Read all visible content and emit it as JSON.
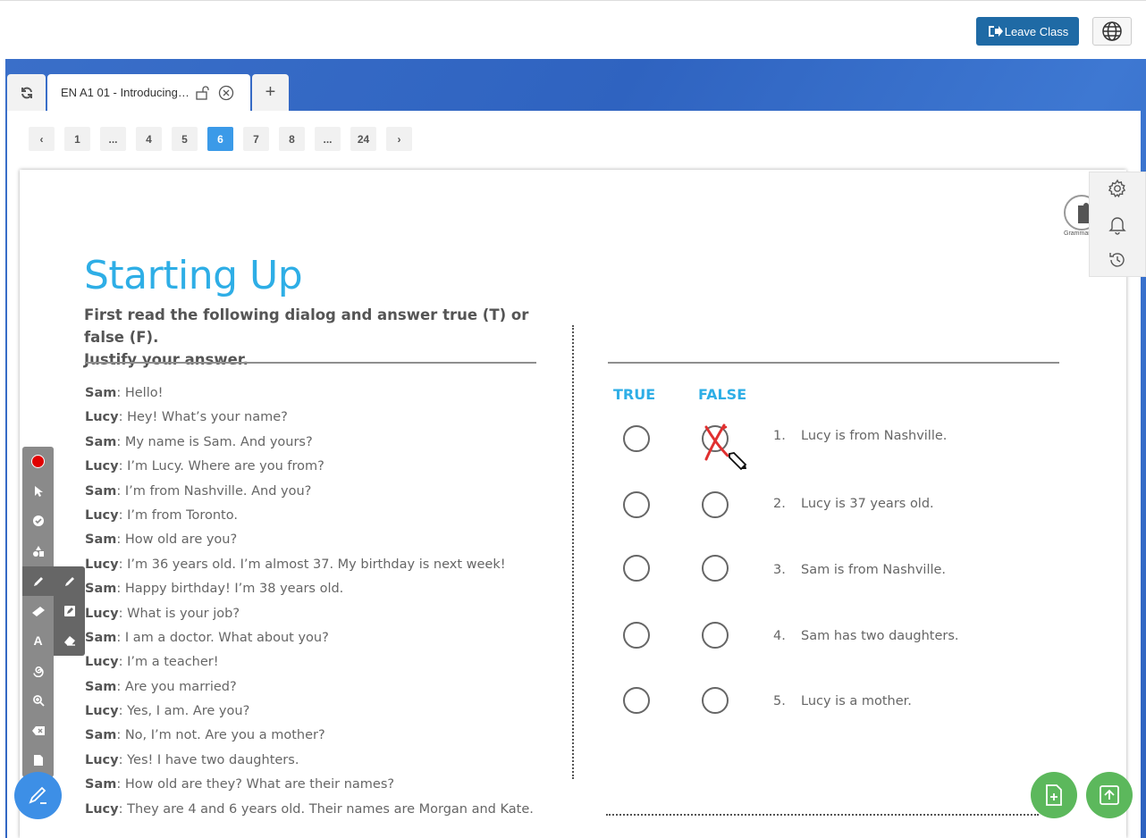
{
  "header": {
    "leave_label": "Leave Class"
  },
  "tabs": {
    "main_title": "EN A1 01 - Introducing Yourself",
    "add_label": "+"
  },
  "pager": {
    "prev": "‹",
    "next": "›",
    "pages": [
      "1",
      "...",
      "4",
      "5",
      "6",
      "7",
      "8",
      "...",
      "24"
    ],
    "active": "6"
  },
  "lesson": {
    "title": "Starting Up",
    "instruction_line1": "First read the following dialog and answer true (T) or false (F).",
    "instruction_line2": "Justify your answer.",
    "true_label": "TRUE",
    "false_label": "FALSE",
    "grammar_label": "Grammar",
    "dialog": [
      {
        "speaker": "Sam",
        "text": ": Hello!"
      },
      {
        "speaker": "Lucy",
        "text": ": Hey! What’s your name?"
      },
      {
        "speaker": "Sam",
        "text": ": My name is Sam. And yours?"
      },
      {
        "speaker": "Lucy",
        "text": ": I’m Lucy. Where are you from?"
      },
      {
        "speaker": "Sam",
        "text": ": I’m from Nashville. And you?"
      },
      {
        "speaker": "Lucy",
        "text": ": I’m from Toronto."
      },
      {
        "speaker": "Sam",
        "text": ": How old are you?"
      },
      {
        "speaker": "Lucy",
        "text": ": I’m 36 years old. I’m almost 37. My birthday is next week!"
      },
      {
        "speaker": "Sam",
        "text": ": Happy birthday! I’m 38 years old."
      },
      {
        "speaker": "Lucy",
        "text": ": What is your job?"
      },
      {
        "speaker": "Sam",
        "text": ": I am a doctor. What about you?"
      },
      {
        "speaker": "Lucy",
        "text": ": I’m a teacher!"
      },
      {
        "speaker": "Sam",
        "text": ": Are you married?"
      },
      {
        "speaker": "Lucy",
        "text": ": Yes, I am. Are you?"
      },
      {
        "speaker": "Sam",
        "text": ": No, I’m not. Are you a mother?"
      },
      {
        "speaker": "Lucy",
        "text": ": Yes! I have two daughters."
      },
      {
        "speaker": "Sam",
        "text": ": How old are they? What are their names?"
      },
      {
        "speaker": "Lucy",
        "text": ": They are 4 and 6 years old. Their names are Morgan and Kate."
      }
    ],
    "statements": [
      {
        "num": "1.",
        "text": "Lucy is from Nashville."
      },
      {
        "num": "2.",
        "text": "Lucy is 37 years old."
      },
      {
        "num": "3.",
        "text": "Sam is from Nashville."
      },
      {
        "num": "4.",
        "text": "Sam has two daughters."
      },
      {
        "num": "5.",
        "text": "Lucy is a mother."
      }
    ],
    "marked": {
      "statement": "1.",
      "answer": "FALSE"
    }
  },
  "toolbar": {
    "text_tool_label": "A",
    "active_color": "#e00000",
    "tools": [
      "color-dot",
      "pointer",
      "check",
      "shapes",
      "pencil",
      "ruler",
      "text",
      "spiral",
      "zoom",
      "delete",
      "document"
    ],
    "sub_tools": [
      "pen",
      "highlighter",
      "eraser"
    ]
  },
  "colors": {
    "brand_blue": "#1f6aa5",
    "heading": "#2eaee6",
    "active_page": "#3b9ae8",
    "fab_green": "#5cb85c",
    "fab_blue": "#3d8fe6",
    "annotation_red": "#e03030"
  }
}
